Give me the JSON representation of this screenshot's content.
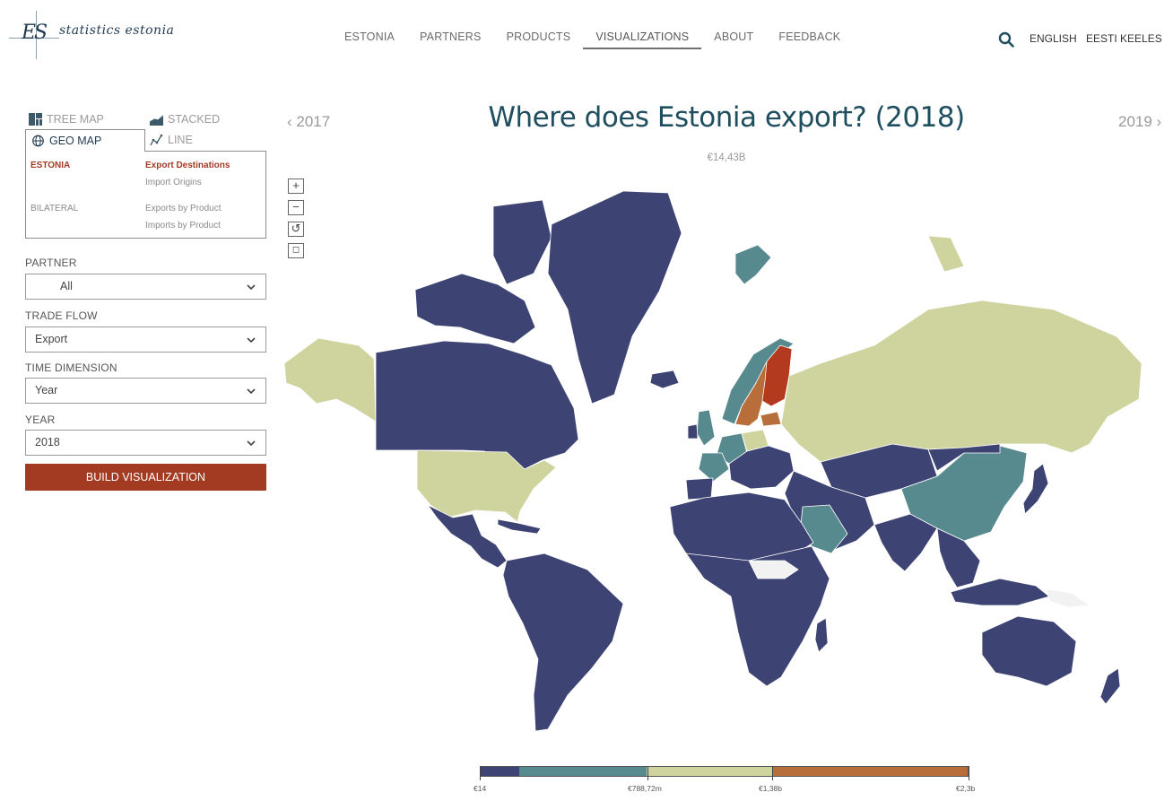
{
  "brand": {
    "wordmark": "statistics estonia",
    "mark": "ES"
  },
  "nav": {
    "items": [
      "ESTONIA",
      "PARTNERS",
      "PRODUCTS",
      "VISUALIZATIONS",
      "ABOUT",
      "FEEDBACK"
    ],
    "active": "VISUALIZATIONS"
  },
  "header": {
    "lang_en": "ENGLISH",
    "lang_et": "EESTI KEELES",
    "search_icon": "search-icon"
  },
  "viz_types": {
    "treemap": "TREE MAP",
    "stacked": "STACKED",
    "geomap": "GEO MAP",
    "line": "LINE",
    "selected": "GEO MAP"
  },
  "submenu": {
    "estonia": "ESTONIA",
    "bilateral": "BILATERAL",
    "export_destinations": "Export Destinations",
    "import_origins": "Import Origins",
    "exports_by_product": "Exports by Product",
    "imports_by_product": "Imports by Product"
  },
  "filters": {
    "partner_label": "PARTNER",
    "partner_value": "All",
    "trade_flow_label": "TRADE FLOW",
    "trade_flow_value": "Export",
    "time_dimension_label": "TIME DIMENSION",
    "time_dimension_value": "Year",
    "year_label": "YEAR",
    "year_value": "2018"
  },
  "build_button": "BUILD VISUALIZATION",
  "main": {
    "title": "Where does Estonia export? (2018)",
    "prev_year": "2017",
    "next_year": "2019",
    "total": "€14,43B"
  },
  "map_controls": {
    "zoom_in": "+",
    "zoom_out": "−",
    "reset": "↺",
    "fit": "◻"
  },
  "legend": {
    "colors": [
      "#3d4473",
      "#578a8e",
      "#cfd49e",
      "#b86e3a"
    ],
    "labels": [
      "€14",
      "€788,72m",
      "€1,38b",
      "€2,3b"
    ],
    "stops": [
      0,
      0.08,
      0.34,
      0.6,
      1.0
    ]
  },
  "map_colors": {
    "low": "#3d4473",
    "mid_low": "#578a8e",
    "mid": "#cfd49e",
    "high": "#b86e3a",
    "top": "#b3391f",
    "nodata": "#f2f2f2"
  }
}
